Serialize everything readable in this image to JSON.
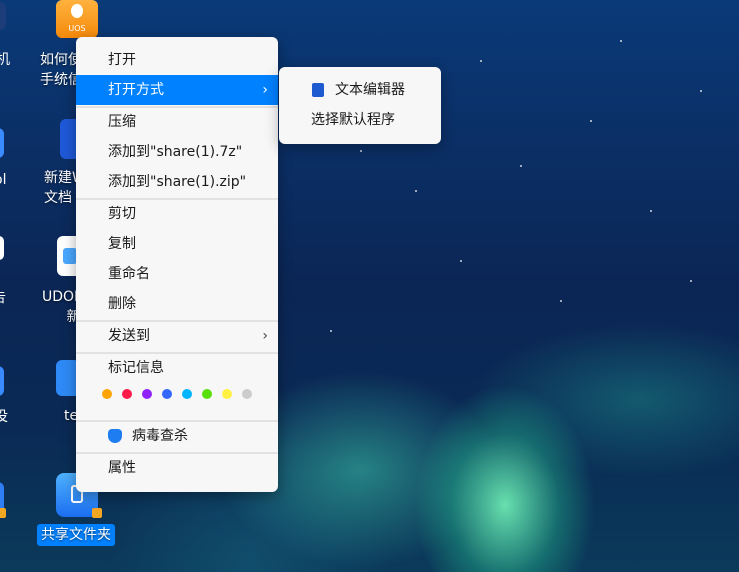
{
  "desktop": {
    "icons": [
      {
        "label_line1": "如何使",
        "label_line2": "手统信"
      },
      {
        "label_line1": "新建W",
        "label_line2": "文档"
      },
      {
        "label_line1": "UDON",
        "label_line2": "新"
      },
      {
        "label_line1": "te",
        "label_line2": ""
      },
      {
        "label_line1": "共享文件夹",
        "label_line2": ""
      }
    ],
    "left_edge_fragments": [
      "机",
      "ol",
      "告",
      "没"
    ],
    "uos_badge": "UOS"
  },
  "context_menu": {
    "open": "打开",
    "open_with": "打开方式",
    "compress": "压缩",
    "add_to_7z": "添加到\"share(1).7z\"",
    "add_to_zip": "添加到\"share(1).zip\"",
    "cut": "剪切",
    "copy": "复制",
    "rename": "重命名",
    "delete": "删除",
    "send_to": "发送到",
    "tag_info": "标记信息",
    "virus_scan": "病毒查杀",
    "properties": "属性",
    "tag_colors": [
      "#ffa503",
      "#ff1c49",
      "#9023fc",
      "#3468ff",
      "#00b5ff",
      "#58df0a",
      "#fef144",
      "#cccccc"
    ]
  },
  "open_with_submenu": {
    "text_editor": "文本编辑器",
    "choose_default": "选择默认程序"
  },
  "colors": {
    "accent": "#0081ff"
  }
}
